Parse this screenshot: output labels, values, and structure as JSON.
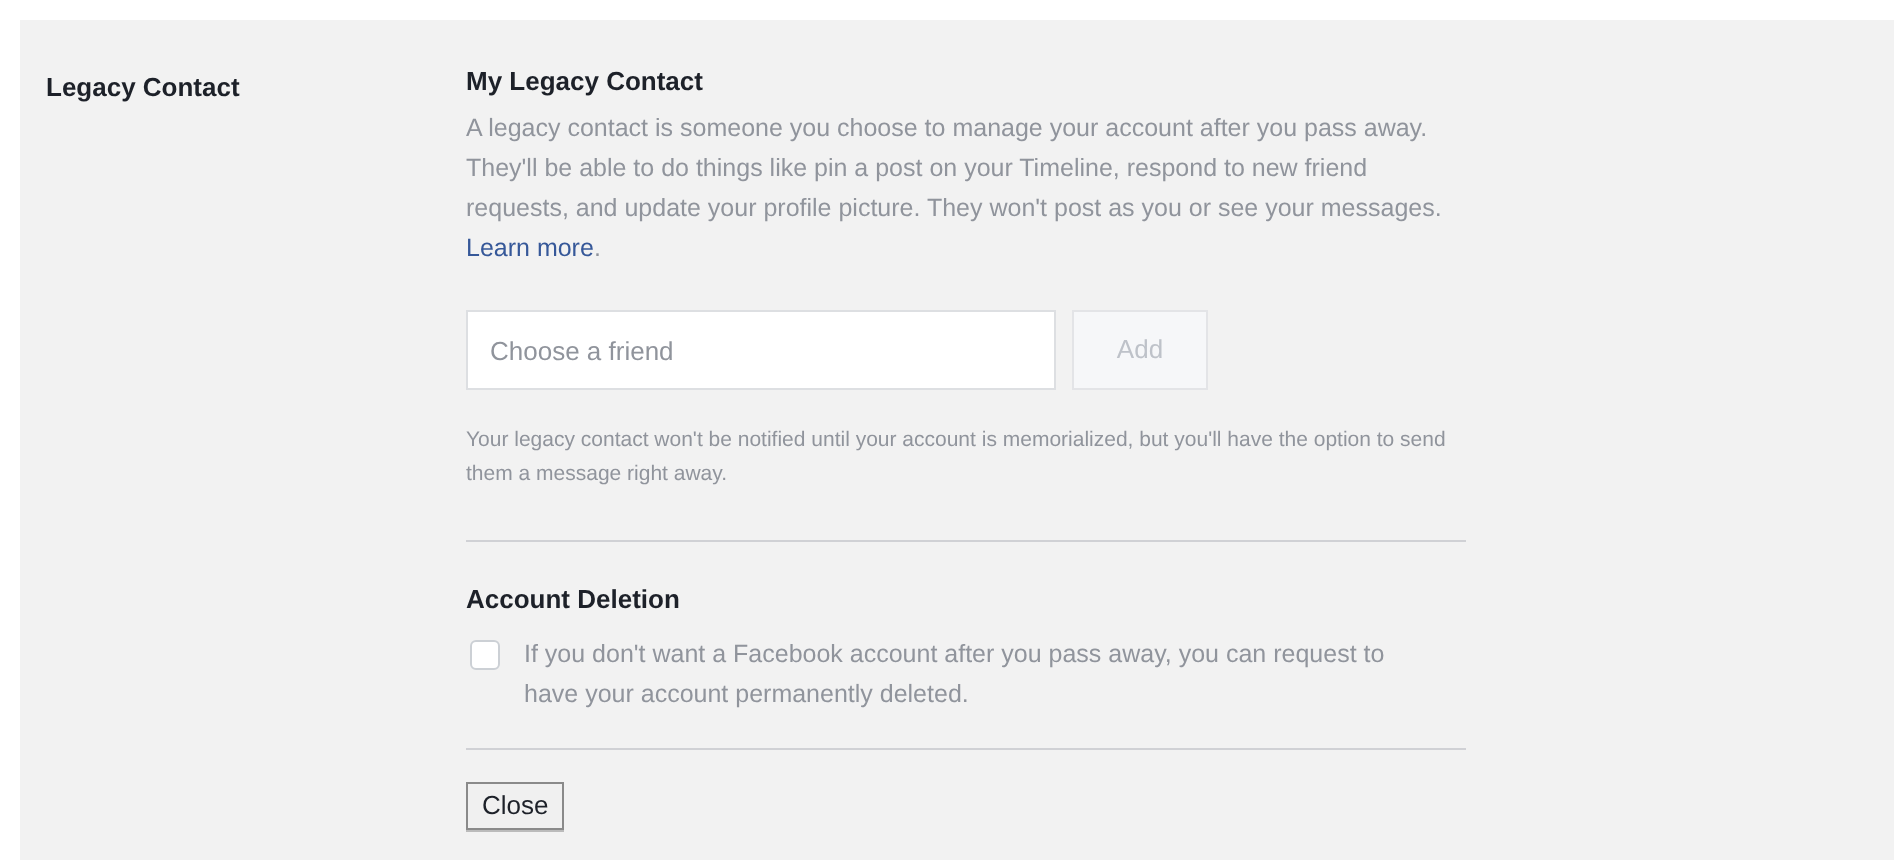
{
  "section_label": "Legacy Contact",
  "legacy_contact": {
    "heading": "My Legacy Contact",
    "description": "A legacy contact is someone you choose to manage your account after you pass away. They'll be able to do things like pin a post on your Timeline, respond to new friend requests, and update your profile picture. They won't post as you or see your messages.",
    "link": "Learn more",
    "after_link": ".",
    "friend_field": {
      "placeholder": "Choose a friend"
    },
    "add_button": {
      "label": "Add",
      "disabled": true
    },
    "note": "Your legacy contact won't be notified until your account is memorialized, but you'll have the option to send them a message right away."
  },
  "account_deletion": {
    "heading": "Account Deletion",
    "checkbox": {
      "label": "If you don't want a Facebook account after you pass away, you can request to have your account permanently deleted.",
      "checked": false
    }
  },
  "close_button": "Close"
}
